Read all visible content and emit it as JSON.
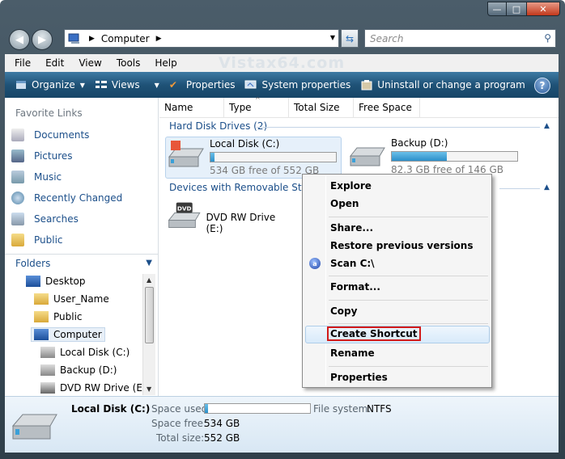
{
  "window": {
    "min": "—",
    "max": "□",
    "close": "✕"
  },
  "address": {
    "crumb": "Computer"
  },
  "search": {
    "placeholder": "Search"
  },
  "watermark": "Vistax64.com",
  "menu": [
    "File",
    "Edit",
    "View",
    "Tools",
    "Help"
  ],
  "toolbar": {
    "organize": "Organize",
    "views": "Views",
    "properties": "Properties",
    "system_properties": "System properties",
    "uninstall": "Uninstall or change a program",
    "more": "»",
    "help": "?"
  },
  "sidebar": {
    "favorites_header": "Favorite Links",
    "favorites": [
      "Documents",
      "Pictures",
      "Music",
      "Recently Changed",
      "Searches",
      "Public"
    ],
    "folders_header": "Folders",
    "tree": [
      "Desktop",
      "User_Name",
      "Public",
      "Computer",
      "Local Disk (C:)",
      "Backup (D:)",
      "DVD RW Drive (E:)"
    ]
  },
  "columns": [
    "Name",
    "Type",
    "Total Size",
    "Free Space"
  ],
  "groups": {
    "hdd": "Hard Disk Drives (2)",
    "removable": "Devices with Removable Storag"
  },
  "drives": [
    {
      "name": "Local Disk (C:)",
      "free": "534 GB free of 552 GB",
      "used_fraction": 0.033
    },
    {
      "name": "Backup (D:)",
      "free": "82.3 GB free of 146 GB",
      "used_fraction": 0.436
    },
    {
      "name": "DVD RW Drive (E:)",
      "dvd_label": "DVD"
    }
  ],
  "context_menu": {
    "explore": "Explore",
    "open": "Open",
    "share": "Share...",
    "restore": "Restore previous versions",
    "scan": "Scan C:\\",
    "scan_icon": "a",
    "format": "Format...",
    "copy": "Copy",
    "create_shortcut": "Create Shortcut",
    "rename": "Rename",
    "properties": "Properties"
  },
  "details": {
    "name": "Local Disk (C:)",
    "space_used_label": "Space used:",
    "space_used_fraction": 0.033,
    "filesystem_label": "File system:",
    "filesystem": "NTFS",
    "space_free_label": "Space free:",
    "space_free": "534 GB",
    "total_size_label": "Total size:",
    "total_size": "552 GB"
  },
  "colors": {
    "accent": "#1c4f8a",
    "toolbar": "#1f5277",
    "highlight_border": "#d21a1a"
  }
}
